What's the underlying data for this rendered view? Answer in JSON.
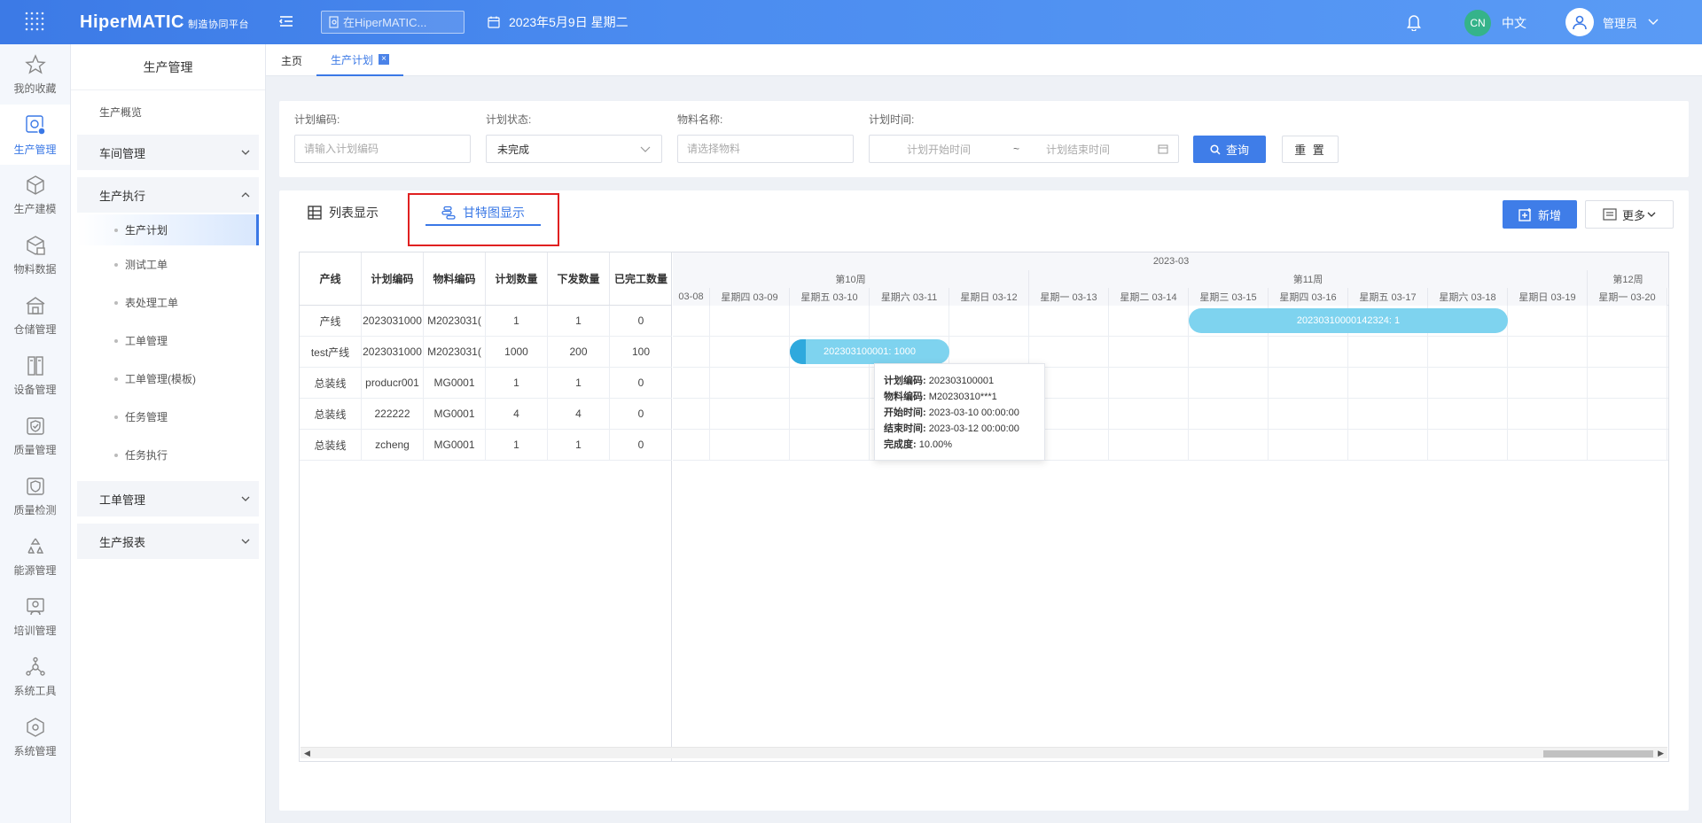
{
  "header": {
    "brand": "HiperMATIC",
    "brand_sub": "制造协同平台",
    "search_placeholder": "在HiperMATIC...",
    "date": "2023年5月9日 星期二",
    "lang_badge": "CN",
    "lang_label": "中文",
    "user_name": "管理员"
  },
  "rail": {
    "items": [
      {
        "label": "我的收藏",
        "icon": "star-icon"
      },
      {
        "label": "生产管理",
        "icon": "production-icon"
      },
      {
        "label": "生产建模",
        "icon": "cube-icon"
      },
      {
        "label": "物料数据",
        "icon": "box-data-icon"
      },
      {
        "label": "仓储管理",
        "icon": "warehouse-icon"
      },
      {
        "label": "设备管理",
        "icon": "device-icon"
      },
      {
        "label": "质量管理",
        "icon": "quality-icon"
      },
      {
        "label": "质量检测",
        "icon": "inspection-icon"
      },
      {
        "label": "能源管理",
        "icon": "energy-icon"
      },
      {
        "label": "培训管理",
        "icon": "training-icon"
      },
      {
        "label": "系统工具",
        "icon": "tools-icon"
      },
      {
        "label": "系统管理",
        "icon": "system-icon"
      }
    ]
  },
  "sidebar": {
    "title": "生产管理",
    "overview": "生产概览",
    "workshop": "车间管理",
    "execution": "生产执行",
    "sub_items": [
      "生产计划",
      "测试工单",
      "表处理工单",
      "工单管理",
      "工单管理(模板)",
      "任务管理",
      "任务执行"
    ],
    "workorder": "工单管理",
    "report": "生产报表"
  },
  "tabs": {
    "home": "主页",
    "plan": "生产计划"
  },
  "filter": {
    "code_label": "计划编码:",
    "code_placeholder": "请输入计划编码",
    "status_label": "计划状态:",
    "status_value": "未完成",
    "material_label": "物料名称:",
    "material_placeholder": "请选择物料",
    "time_label": "计划时间:",
    "start_placeholder": "计划开始时间",
    "range_sep": "~",
    "end_placeholder": "计划结束时间",
    "query": "查询",
    "reset": "重 置"
  },
  "view": {
    "list_tab": "列表显示",
    "gantt_tab": "甘特图显示",
    "add": "新增",
    "more": "更多"
  },
  "grid": {
    "columns": [
      "产线",
      "计划编码",
      "物料编码",
      "计划数量",
      "下发数量",
      "已完工数量"
    ],
    "rows": [
      [
        "产线",
        "2023031000",
        "M2023031(",
        "1",
        "1",
        "0"
      ],
      [
        "test产线",
        "2023031000",
        "M2023031(",
        "1000",
        "200",
        "100"
      ],
      [
        "总装线",
        "producr001",
        "MG0001",
        "1",
        "1",
        "0"
      ],
      [
        "总装线",
        "222222",
        "MG0001",
        "4",
        "4",
        "0"
      ],
      [
        "总装线",
        "zcheng",
        "MG0001",
        "1",
        "1",
        "0"
      ]
    ]
  },
  "scale": {
    "month": "2023-03",
    "weeks": [
      "第10周",
      "第11周",
      "第12周"
    ],
    "days": [
      "03-08",
      "星期四 03-09",
      "星期五 03-10",
      "星期六 03-11",
      "星期日 03-12",
      "星期一 03-13",
      "星期二 03-14",
      "星期三 03-15",
      "星期四 03-16",
      "星期五 03-17",
      "星期六 03-18",
      "星期日 03-19",
      "星期一 03-20"
    ]
  },
  "bars": [
    {
      "label": "20230310000142324: 1",
      "progress": 0
    },
    {
      "label": "202303100001: 1000",
      "progress": 0.1
    }
  ],
  "tooltip": {
    "code_k": "计划编码:",
    "code_v": "202303100001",
    "mat_k": "物料编码:",
    "mat_v": "M20230310***1",
    "start_k": "开始时间:",
    "start_v": "2023-03-10 00:00:00",
    "end_k": "结束时间:",
    "end_v": "2023-03-12 00:00:00",
    "prog_k": "完成度:",
    "prog_v": "10.00%"
  }
}
